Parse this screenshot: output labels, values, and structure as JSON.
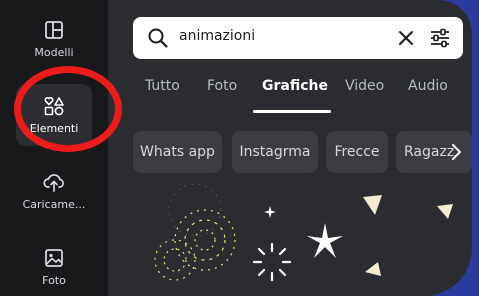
{
  "sidebar": {
    "items": [
      {
        "label": "Modelli",
        "icon": "layout-icon"
      },
      {
        "label": "Elementi",
        "icon": "shapes-icon"
      },
      {
        "label": "Caricame...",
        "icon": "cloud-upload-icon"
      },
      {
        "label": "Foto",
        "icon": "image-icon"
      }
    ],
    "active": "Elementi"
  },
  "search": {
    "value": "animazioni",
    "icon": "search-icon",
    "clear_icon": "close-icon",
    "filter_icon": "filter-icon"
  },
  "tabs": [
    {
      "label": "Tutto"
    },
    {
      "label": "Foto"
    },
    {
      "label": "Grafiche"
    },
    {
      "label": "Video"
    },
    {
      "label": "Audio"
    }
  ],
  "active_tab": "Grafiche",
  "chips": [
    {
      "label": "Whats app"
    },
    {
      "label": "Instagrma"
    },
    {
      "label": "Frecce"
    },
    {
      "label": "Ragazz"
    }
  ],
  "chip_next_icon": "chevron-right-icon",
  "colors": {
    "accent_highlight": "#ee1b1b",
    "background": "#2a2c30",
    "sidebar": "#18191b",
    "firework_yellow": "#e8e07a",
    "shape_cream": "#f3ecd3"
  }
}
